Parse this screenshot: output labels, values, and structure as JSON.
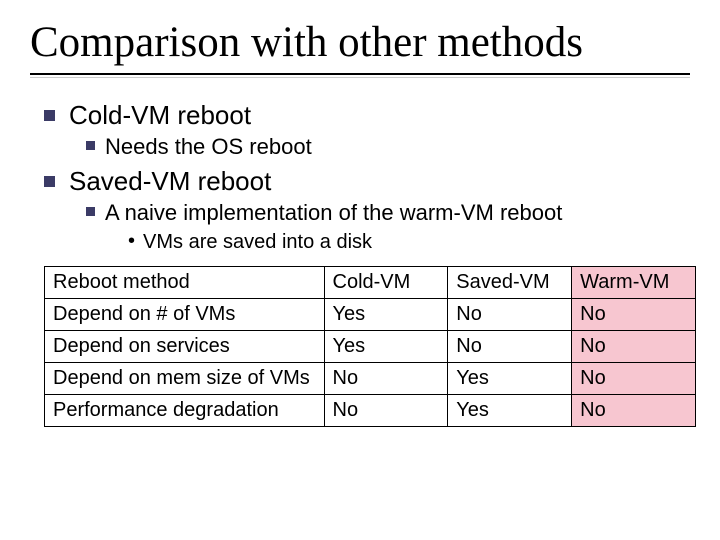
{
  "title": "Comparison with other methods",
  "bullets": {
    "b1": "Cold-VM reboot",
    "b1_1": "Needs the OS reboot",
    "b2": "Saved-VM reboot",
    "b2_1": "A naive implementation of the warm-VM reboot",
    "b2_1_1": "VMs are saved into a disk"
  },
  "table": {
    "headers": {
      "method": "Reboot method",
      "col1": "Cold-VM",
      "col2": "Saved-VM",
      "col3": "Warm-VM"
    },
    "rows": [
      {
        "label": "Depend on # of VMs",
        "c1": "Yes",
        "c2": "No",
        "c3": "No"
      },
      {
        "label": "Depend on services",
        "c1": "Yes",
        "c2": "No",
        "c3": "No"
      },
      {
        "label": "Depend on mem size of VMs",
        "c1": "No",
        "c2": "Yes",
        "c3": "No"
      },
      {
        "label": "Performance degradation",
        "c1": "No",
        "c2": "Yes",
        "c3": "No"
      }
    ]
  },
  "chart_data": {
    "type": "table",
    "title": "Comparison with other methods",
    "columns": [
      "Reboot method",
      "Cold-VM",
      "Saved-VM",
      "Warm-VM"
    ],
    "rows": [
      [
        "Depend on # of VMs",
        "Yes",
        "No",
        "No"
      ],
      [
        "Depend on services",
        "Yes",
        "No",
        "No"
      ],
      [
        "Depend on mem size of VMs",
        "No",
        "Yes",
        "No"
      ],
      [
        "Performance degradation",
        "No",
        "Yes",
        "No"
      ]
    ],
    "highlight_column": "Warm-VM"
  }
}
